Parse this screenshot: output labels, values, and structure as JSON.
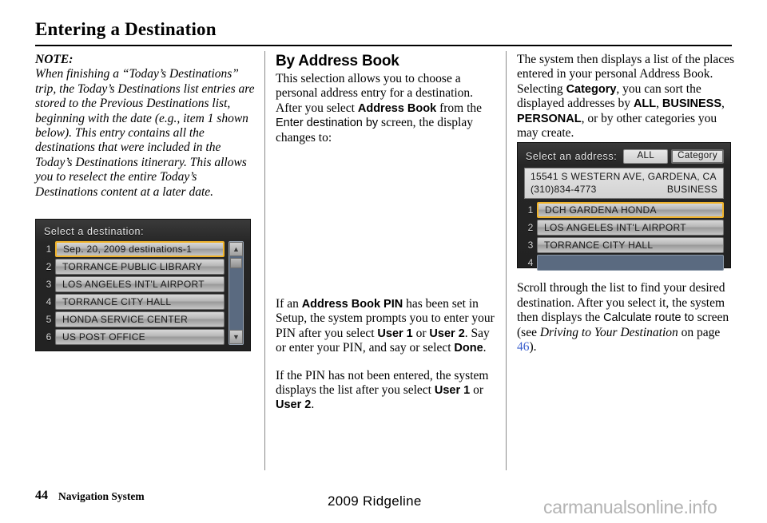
{
  "page": {
    "title": "Entering a Destination",
    "footer_page_number": "44",
    "footer_section": "Navigation System",
    "footer_model": "2009  Ridgeline",
    "watermark": "carmanualsonline.info"
  },
  "left_column": {
    "note_label": "NOTE:",
    "note_text": "When finishing a “Today’s Destinations” trip, the Today’s Destinations list entries are stored to the Previous Destinations list, beginning with the date (e.g., item 1 shown below). This entry contains all the destinations that were included in the Today’s Destinations itinerary. This allows you to reselect the entire Today’s Destinations content at a later date.",
    "nav_screen": {
      "header": "Select a destination:",
      "rows": [
        {
          "num": "1",
          "label": "Sep. 20, 2009 destinations-1",
          "selected": true
        },
        {
          "num": "2",
          "label": "TORRANCE PUBLIC LIBRARY",
          "selected": false
        },
        {
          "num": "3",
          "label": "LOS ANGELES INT'L AIRPORT",
          "selected": false
        },
        {
          "num": "4",
          "label": "TORRANCE CITY HALL",
          "selected": false
        },
        {
          "num": "5",
          "label": "HONDA SERVICE CENTER",
          "selected": false
        },
        {
          "num": "6",
          "label": "US POST OFFICE",
          "selected": false
        }
      ],
      "scroll_up": "▲",
      "scroll_down": "▼"
    }
  },
  "middle_column": {
    "heading": "By Address Book",
    "para1": {
      "t1": "This selection allows you to choose a personal address entry for a destination. After you select ",
      "b1": "Address Book",
      "t2": " from the ",
      "ui1": "Enter destination by",
      "t3": " screen, the display changes to:"
    },
    "para2": {
      "t1": "If an ",
      "b1": "Address Book PIN",
      "t2": " has been set in Setup, the system prompts you to enter your PIN after you select ",
      "b2": "User 1",
      "t3": " or ",
      "b3": "User 2",
      "t4": ". Say or enter your PIN, and say or select ",
      "b4": "Done",
      "t5": "."
    },
    "para3": {
      "t1": "If the PIN has not been entered, the system displays the list after you select ",
      "b1": "User 1",
      "t2": " or ",
      "b2": "User 2",
      "t3": "."
    }
  },
  "right_column": {
    "para1": {
      "t1": "The system then displays a list of the places entered in your personal Address Book. Selecting ",
      "b1": "Category",
      "t2": ", you can sort the displayed addresses by ",
      "b2": "ALL",
      "t3": ", ",
      "b3": "BUSINESS",
      "t4": ", ",
      "b4": "PERSONAL",
      "t5": ", or by other categories you may create."
    },
    "nav_screen": {
      "header": "Select an address:",
      "btn_all": "ALL",
      "btn_category": "Category",
      "address_line1": "15541 S WESTERN AVE, GARDENA, CA",
      "address_phone": "(310)834-4773",
      "address_category": "BUSINESS",
      "rows": [
        {
          "num": "1",
          "label": "DCH GARDENA HONDA",
          "selected": true,
          "empty": false
        },
        {
          "num": "2",
          "label": "LOS ANGELES INT'L AIRPORT",
          "selected": false,
          "empty": false
        },
        {
          "num": "3",
          "label": "TORRANCE CITY HALL",
          "selected": false,
          "empty": false
        },
        {
          "num": "4",
          "label": "",
          "selected": false,
          "empty": true
        }
      ]
    },
    "para2": {
      "t1": "Scroll through the list to find your desired destination. After you select it, the system then displays the ",
      "ui1": "Calculate route to",
      "t2": " screen (see ",
      "i1": "Driving to Your Destination",
      "t3": " on page ",
      "page": "46",
      "t4": ")."
    }
  },
  "colors": {
    "highlight": "#f0b32a",
    "screen_bg": "#2a2a2a",
    "empty_row": "#5a6a80",
    "page_ref": "#3a5fcd"
  }
}
